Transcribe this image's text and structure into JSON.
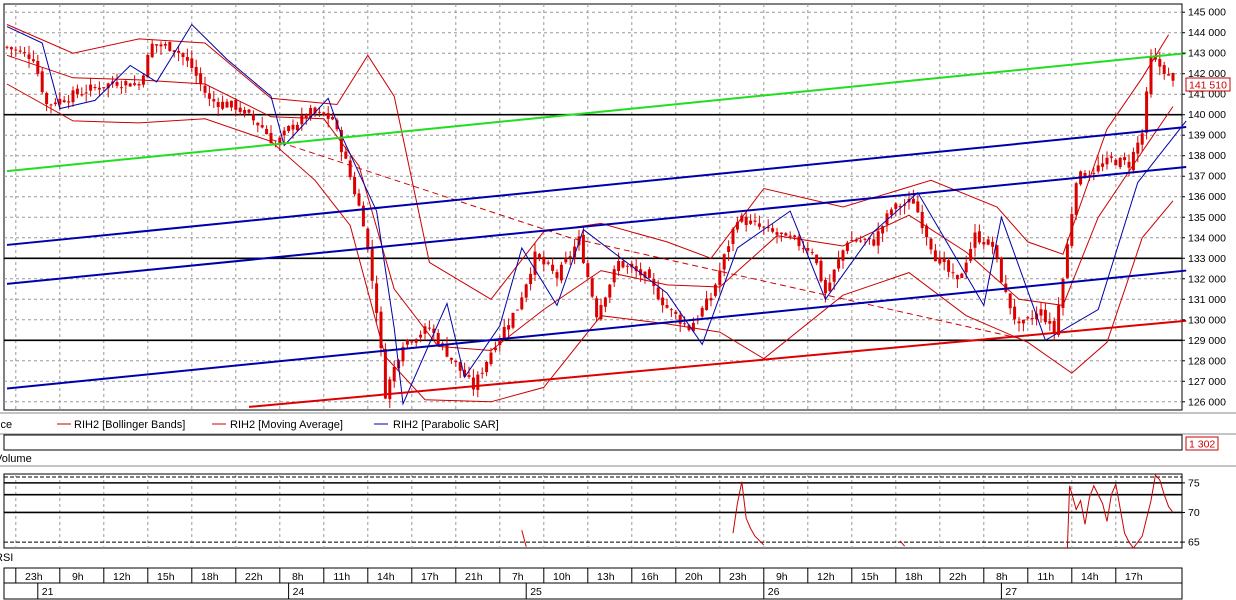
{
  "chart_data": [
    {
      "type": "line",
      "panel": "price",
      "ylim": [
        125600,
        145400
      ],
      "y_ticks": [
        "126 000",
        "127 000",
        "128 000",
        "129 000",
        "130 000",
        "131 000",
        "132 000",
        "133 000",
        "134 000",
        "135 000",
        "136 000",
        "137 000",
        "138 000",
        "139 000",
        "140 000",
        "141 000",
        "142 000",
        "143 000",
        "144 000",
        "145 000"
      ],
      "price_badge": "141 510",
      "horizontal_lines": [
        140000,
        133000,
        129000
      ],
      "trend_lines": [
        {
          "color": "#22dd22",
          "from": {
            "bar": 0,
            "y": 137250
          },
          "to": {
            "bar": 268,
            "y": 143000
          }
        },
        {
          "color": "#0000aa",
          "from": {
            "bar": 0,
            "y": 133650
          },
          "to": {
            "bar": 268,
            "y": 139400
          }
        },
        {
          "color": "#0000aa",
          "from": {
            "bar": 0,
            "y": 131750
          },
          "to": {
            "bar": 268,
            "y": 137450
          }
        },
        {
          "color": "#0000aa",
          "from": {
            "bar": 0,
            "y": 126650
          },
          "to": {
            "bar": 268,
            "y": 132400
          }
        },
        {
          "color": "#dd0000",
          "from": {
            "bar": 55,
            "y": 125750
          },
          "to": {
            "bar": 268,
            "y": 129950
          }
        }
      ],
      "series": [
        {
          "name": "RIH2 [Bollinger Bands]",
          "color": "#cc0000"
        },
        {
          "name": "RIH2 [Moving Average]",
          "color": "#cc0000"
        },
        {
          "name": "RIH2 [Parabolic SAR]",
          "color": "#0000aa"
        }
      ],
      "price_path": [
        {
          "bar": 0,
          "y": 143300
        },
        {
          "bar": 6,
          "y": 142800
        },
        {
          "bar": 9,
          "y": 140500
        },
        {
          "bar": 13,
          "y": 140800
        },
        {
          "bar": 18,
          "y": 141200
        },
        {
          "bar": 25,
          "y": 141600
        },
        {
          "bar": 30,
          "y": 141500
        },
        {
          "bar": 33,
          "y": 143400
        },
        {
          "bar": 38,
          "y": 143300
        },
        {
          "bar": 42,
          "y": 142300
        },
        {
          "bar": 46,
          "y": 140700
        },
        {
          "bar": 52,
          "y": 140400
        },
        {
          "bar": 58,
          "y": 139400
        },
        {
          "bar": 61,
          "y": 138500
        },
        {
          "bar": 64,
          "y": 139300
        },
        {
          "bar": 69,
          "y": 140100
        },
        {
          "bar": 74,
          "y": 139800
        },
        {
          "bar": 77,
          "y": 137700
        },
        {
          "bar": 81,
          "y": 134800
        },
        {
          "bar": 84,
          "y": 130500
        },
        {
          "bar": 86,
          "y": 126400
        },
        {
          "bar": 90,
          "y": 128900
        },
        {
          "bar": 96,
          "y": 129600
        },
        {
          "bar": 101,
          "y": 128100
        },
        {
          "bar": 106,
          "y": 126700
        },
        {
          "bar": 111,
          "y": 128900
        },
        {
          "bar": 116,
          "y": 130600
        },
        {
          "bar": 120,
          "y": 133100
        },
        {
          "bar": 125,
          "y": 132100
        },
        {
          "bar": 130,
          "y": 133900
        },
        {
          "bar": 134,
          "y": 130300
        },
        {
          "bar": 139,
          "y": 132800
        },
        {
          "bar": 145,
          "y": 132100
        },
        {
          "bar": 150,
          "y": 130600
        },
        {
          "bar": 155,
          "y": 129600
        },
        {
          "bar": 160,
          "y": 131100
        },
        {
          "bar": 166,
          "y": 135000
        },
        {
          "bar": 172,
          "y": 134400
        },
        {
          "bar": 178,
          "y": 133900
        },
        {
          "bar": 183,
          "y": 133400
        },
        {
          "bar": 186,
          "y": 131300
        },
        {
          "bar": 191,
          "y": 133900
        },
        {
          "bar": 197,
          "y": 133800
        },
        {
          "bar": 201,
          "y": 135400
        },
        {
          "bar": 206,
          "y": 135800
        },
        {
          "bar": 211,
          "y": 133100
        },
        {
          "bar": 216,
          "y": 131800
        },
        {
          "bar": 220,
          "y": 134100
        },
        {
          "bar": 224,
          "y": 133600
        },
        {
          "bar": 227,
          "y": 131200
        },
        {
          "bar": 230,
          "y": 129600
        },
        {
          "bar": 235,
          "y": 130400
        },
        {
          "bar": 238,
          "y": 129400
        },
        {
          "bar": 240,
          "y": 132000
        },
        {
          "bar": 243,
          "y": 136900
        },
        {
          "bar": 247,
          "y": 137300
        },
        {
          "bar": 251,
          "y": 137800
        },
        {
          "bar": 255,
          "y": 137600
        },
        {
          "bar": 258,
          "y": 139100
        },
        {
          "bar": 260,
          "y": 142700
        },
        {
          "bar": 263,
          "y": 142200
        },
        {
          "bar": 265,
          "y": 141510
        }
      ],
      "ma_path": [
        {
          "bar": 0,
          "y": 142900
        },
        {
          "bar": 15,
          "y": 141800
        },
        {
          "bar": 30,
          "y": 141700
        },
        {
          "bar": 45,
          "y": 141500
        },
        {
          "bar": 60,
          "y": 139900
        },
        {
          "bar": 72,
          "y": 139800
        },
        {
          "bar": 80,
          "y": 137500
        },
        {
          "bar": 88,
          "y": 131500
        },
        {
          "bar": 98,
          "y": 128700
        },
        {
          "bar": 110,
          "y": 128500
        },
        {
          "bar": 122,
          "y": 130500
        },
        {
          "bar": 135,
          "y": 132400
        },
        {
          "bar": 150,
          "y": 131700
        },
        {
          "bar": 162,
          "y": 131600
        },
        {
          "bar": 175,
          "y": 134100
        },
        {
          "bar": 190,
          "y": 133600
        },
        {
          "bar": 205,
          "y": 135100
        },
        {
          "bar": 218,
          "y": 133300
        },
        {
          "bar": 230,
          "y": 131000
        },
        {
          "bar": 240,
          "y": 130700
        },
        {
          "bar": 248,
          "y": 135000
        },
        {
          "bar": 258,
          "y": 138200
        },
        {
          "bar": 265,
          "y": 140400
        }
      ],
      "sar_path": [
        {
          "bar": 0,
          "y": 144300
        },
        {
          "bar": 8,
          "y": 143500
        },
        {
          "bar": 12,
          "y": 140300
        },
        {
          "bar": 20,
          "y": 140700
        },
        {
          "bar": 28,
          "y": 142400
        },
        {
          "bar": 34,
          "y": 141600
        },
        {
          "bar": 42,
          "y": 144400
        },
        {
          "bar": 50,
          "y": 142700
        },
        {
          "bar": 60,
          "y": 140900
        },
        {
          "bar": 63,
          "y": 138500
        },
        {
          "bar": 73,
          "y": 140800
        },
        {
          "bar": 76,
          "y": 139000
        },
        {
          "bar": 84,
          "y": 135300
        },
        {
          "bar": 88,
          "y": 129600
        },
        {
          "bar": 90,
          "y": 125900
        },
        {
          "bar": 100,
          "y": 130800
        },
        {
          "bar": 104,
          "y": 127200
        },
        {
          "bar": 112,
          "y": 129700
        },
        {
          "bar": 117,
          "y": 133500
        },
        {
          "bar": 125,
          "y": 130700
        },
        {
          "bar": 131,
          "y": 134400
        },
        {
          "bar": 150,
          "y": 131300
        },
        {
          "bar": 158,
          "y": 128800
        },
        {
          "bar": 166,
          "y": 133500
        },
        {
          "bar": 178,
          "y": 135300
        },
        {
          "bar": 186,
          "y": 131000
        },
        {
          "bar": 197,
          "y": 134300
        },
        {
          "bar": 207,
          "y": 136200
        },
        {
          "bar": 222,
          "y": 130700
        },
        {
          "bar": 226,
          "y": 135000
        },
        {
          "bar": 236,
          "y": 129000
        },
        {
          "bar": 248,
          "y": 130500
        },
        {
          "bar": 257,
          "y": 136700
        },
        {
          "bar": 268,
          "y": 139700
        }
      ],
      "bb_upper": [
        {
          "bar": 0,
          "y": 144400
        },
        {
          "bar": 15,
          "y": 143000
        },
        {
          "bar": 30,
          "y": 143700
        },
        {
          "bar": 45,
          "y": 143500
        },
        {
          "bar": 60,
          "y": 140800
        },
        {
          "bar": 75,
          "y": 140500
        },
        {
          "bar": 82,
          "y": 142900
        },
        {
          "bar": 88,
          "y": 140900
        },
        {
          "bar": 96,
          "y": 132800
        },
        {
          "bar": 110,
          "y": 131000
        },
        {
          "bar": 122,
          "y": 134300
        },
        {
          "bar": 135,
          "y": 134700
        },
        {
          "bar": 150,
          "y": 133800
        },
        {
          "bar": 160,
          "y": 133000
        },
        {
          "bar": 172,
          "y": 136400
        },
        {
          "bar": 190,
          "y": 135500
        },
        {
          "bar": 210,
          "y": 136800
        },
        {
          "bar": 225,
          "y": 135500
        },
        {
          "bar": 232,
          "y": 133800
        },
        {
          "bar": 240,
          "y": 133200
        },
        {
          "bar": 250,
          "y": 139300
        },
        {
          "bar": 258,
          "y": 141800
        },
        {
          "bar": 264,
          "y": 143900
        }
      ],
      "bb_lower": [
        {
          "bar": 0,
          "y": 141500
        },
        {
          "bar": 15,
          "y": 139700
        },
        {
          "bar": 30,
          "y": 139600
        },
        {
          "bar": 45,
          "y": 139800
        },
        {
          "bar": 60,
          "y": 138700
        },
        {
          "bar": 70,
          "y": 136800
        },
        {
          "bar": 78,
          "y": 134600
        },
        {
          "bar": 86,
          "y": 128200
        },
        {
          "bar": 95,
          "y": 126100
        },
        {
          "bar": 110,
          "y": 126000
        },
        {
          "bar": 122,
          "y": 126700
        },
        {
          "bar": 135,
          "y": 130200
        },
        {
          "bar": 150,
          "y": 129800
        },
        {
          "bar": 162,
          "y": 129400
        },
        {
          "bar": 172,
          "y": 128100
        },
        {
          "bar": 190,
          "y": 131200
        },
        {
          "bar": 205,
          "y": 132300
        },
        {
          "bar": 218,
          "y": 130200
        },
        {
          "bar": 232,
          "y": 128900
        },
        {
          "bar": 242,
          "y": 127400
        },
        {
          "bar": 250,
          "y": 128900
        },
        {
          "bar": 258,
          "y": 134000
        },
        {
          "bar": 265,
          "y": 135800
        }
      ]
    },
    {
      "type": "bar",
      "panel": "volume",
      "title": "Volume",
      "value_badge": "1 302"
    },
    {
      "type": "line",
      "panel": "rsi",
      "title": "RSI",
      "ylim": [
        64,
        76.5
      ],
      "y_ticks": [
        "65",
        "70",
        "75"
      ],
      "levels": [
        65,
        70,
        73,
        75,
        76
      ],
      "values": [
        {
          "bar": 117,
          "y": 67.0
        },
        {
          "bar": 118,
          "y": 64.2
        },
        {
          "bar": 165,
          "y": 66.5
        },
        {
          "bar": 166,
          "y": 71.5
        },
        {
          "bar": 167,
          "y": 75.2
        },
        {
          "bar": 168,
          "y": 69.0
        },
        {
          "bar": 169,
          "y": 67.3
        },
        {
          "bar": 170,
          "y": 66.0
        },
        {
          "bar": 172,
          "y": 64.5
        },
        {
          "bar": 203,
          "y": 65.2
        },
        {
          "bar": 204,
          "y": 64.3
        },
        {
          "bar": 241,
          "y": 64.0
        },
        {
          "bar": 241.5,
          "y": 74.5
        },
        {
          "bar": 243,
          "y": 70.5
        },
        {
          "bar": 244,
          "y": 72.0
        },
        {
          "bar": 245,
          "y": 68.0
        },
        {
          "bar": 246,
          "y": 72.5
        },
        {
          "bar": 247,
          "y": 74.5
        },
        {
          "bar": 249,
          "y": 71.5
        },
        {
          "bar": 250,
          "y": 68.5
        },
        {
          "bar": 251,
          "y": 73.0
        },
        {
          "bar": 252,
          "y": 74.8
        },
        {
          "bar": 254,
          "y": 66.5
        },
        {
          "bar": 255,
          "y": 65.0
        },
        {
          "bar": 256,
          "y": 64.0
        },
        {
          "bar": 258,
          "y": 66.0
        },
        {
          "bar": 260,
          "y": 72.0
        },
        {
          "bar": 261,
          "y": 76.3
        },
        {
          "bar": 262,
          "y": 75.5
        },
        {
          "bar": 263,
          "y": 73.0
        },
        {
          "bar": 264,
          "y": 71.0
        },
        {
          "bar": 265,
          "y": 70.0
        }
      ]
    }
  ],
  "time_axis": {
    "hour_labels": [
      {
        "bar": 2,
        "label": "23h"
      },
      {
        "bar": 12,
        "label": "9h"
      },
      {
        "bar": 22,
        "label": "12h"
      },
      {
        "bar": 32,
        "label": "15h"
      },
      {
        "bar": 42,
        "label": "18h"
      },
      {
        "bar": 52,
        "label": "22h"
      },
      {
        "bar": 62,
        "label": "8h"
      },
      {
        "bar": 72,
        "label": "11h"
      },
      {
        "bar": 82,
        "label": "14h"
      },
      {
        "bar": 92,
        "label": "17h"
      },
      {
        "bar": 102,
        "label": "21h"
      },
      {
        "bar": 112,
        "label": "7h"
      },
      {
        "bar": 122,
        "label": "10h"
      },
      {
        "bar": 132,
        "label": "13h"
      },
      {
        "bar": 142,
        "label": "16h"
      },
      {
        "bar": 152,
        "label": "20h"
      },
      {
        "bar": 162,
        "label": "23h"
      },
      {
        "bar": 172,
        "label": "9h"
      },
      {
        "bar": 182,
        "label": "12h"
      },
      {
        "bar": 192,
        "label": "15h"
      },
      {
        "bar": 202,
        "label": "18h"
      },
      {
        "bar": 212,
        "label": "22h"
      },
      {
        "bar": 222,
        "label": "8h"
      },
      {
        "bar": 232,
        "label": "11h"
      },
      {
        "bar": 242,
        "label": "14h"
      },
      {
        "bar": 252,
        "label": "17h"
      }
    ],
    "day_labels": [
      {
        "bar": 7,
        "label": "21"
      },
      {
        "bar": 64,
        "label": "24"
      },
      {
        "bar": 118,
        "label": "25"
      },
      {
        "bar": 172,
        "label": "26"
      },
      {
        "bar": 226,
        "label": "27"
      }
    ]
  },
  "legend": {
    "price_label": "Price",
    "bollinger_label": "RIH2 [Bollinger Bands]",
    "ma_label": "RIH2 [Moving Average]",
    "sar_label": "RIH2 [Parabolic SAR]",
    "volume_label": "Volume",
    "rsi_label": "RSI"
  },
  "colors": {
    "price": "#dd0000",
    "bollinger": "#cc0000",
    "sar": "#0000aa",
    "grid": "#999999"
  }
}
